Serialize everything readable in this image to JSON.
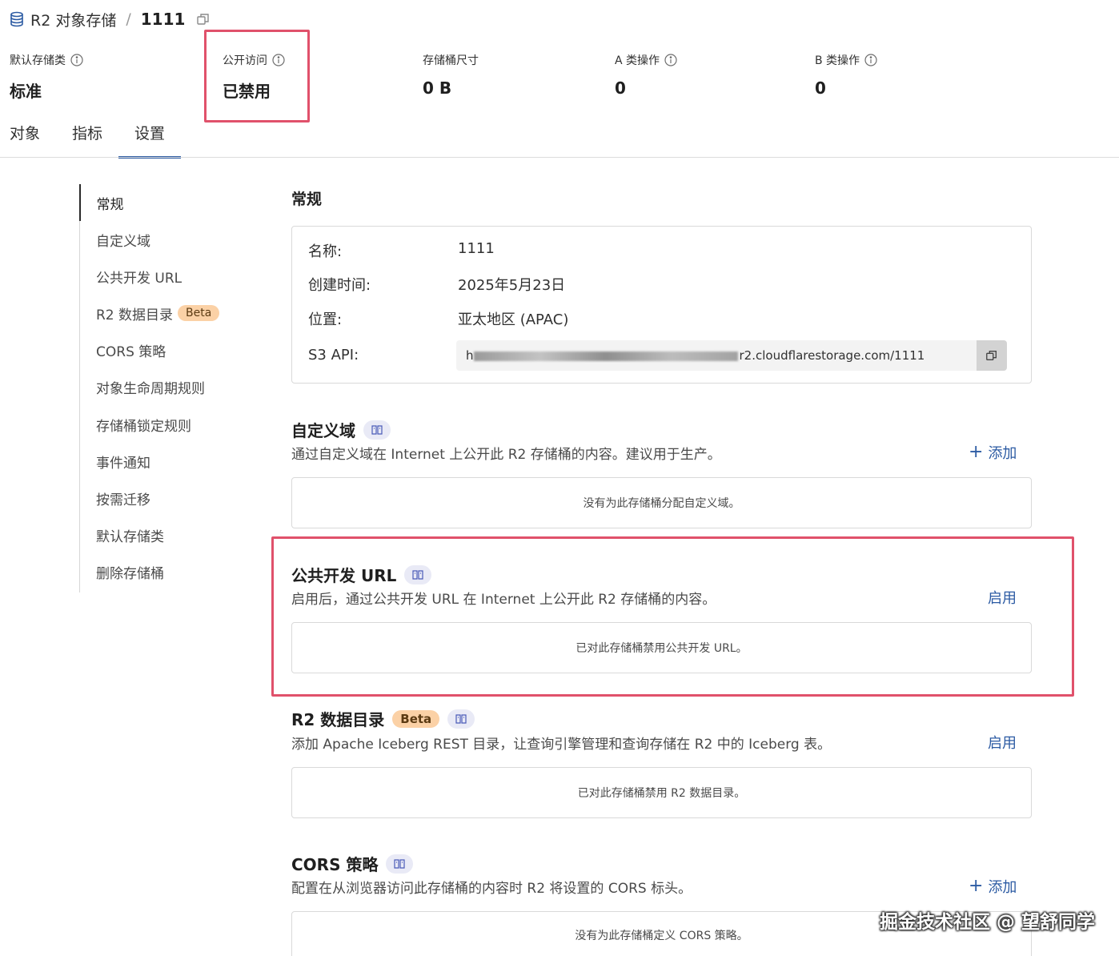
{
  "header": {
    "parent": "R2 对象存储",
    "separator": "/",
    "bucket": "1111"
  },
  "stats": [
    {
      "label": "默认存储类",
      "value": "标准"
    },
    {
      "label": "公开访问",
      "value": "已禁用"
    },
    {
      "label": "存储桶尺寸",
      "value": "0 B"
    },
    {
      "label": "A 类操作",
      "value": "0"
    },
    {
      "label": "B 类操作",
      "value": "0"
    }
  ],
  "tabs": [
    "对象",
    "指标",
    "设置"
  ],
  "sidenav": {
    "items": [
      "常规",
      "自定义域",
      "公共开发 URL",
      "R2 数据目录",
      "CORS 策略",
      "对象生命周期规则",
      "存储桶锁定规则",
      "事件通知",
      "按需迁移",
      "默认存储类",
      "删除存储桶"
    ],
    "beta": "Beta"
  },
  "general": {
    "title": "常规",
    "name_label": "名称:",
    "name_value": "1111",
    "created_label": "创建时间:",
    "created_value": "2025年5月23日",
    "location_label": "位置:",
    "location_value": "亚太地区 (APAC)",
    "s3_label": "S3 API:",
    "s3_prefix": "h",
    "s3_suffix": "r2.cloudflarestorage.com/1111"
  },
  "custom_domain": {
    "title": "自定义域",
    "desc": "通过自定义域在 Internet 上公开此 R2 存储桶的内容。建议用于生产。",
    "action": "添加",
    "empty": "没有为此存储桶分配自定义域。"
  },
  "public_url": {
    "title": "公共开发 URL",
    "desc": "启用后，通过公共开发 URL 在 Internet 上公开此 R2 存储桶的内容。",
    "action": "启用",
    "empty": "已对此存储桶禁用公共开发 URL。"
  },
  "data_catalog": {
    "title": "R2 数据目录",
    "beta": "Beta",
    "desc": "添加 Apache Iceberg REST 目录，让查询引擎管理和查询存储在 R2 中的 Iceberg 表。",
    "action": "启用",
    "empty": "已对此存储桶禁用 R2 数据目录。"
  },
  "cors": {
    "title": "CORS 策略",
    "desc": "配置在从浏览器访问此存储桶的内容时 R2 将设置的 CORS 标头。",
    "action": "添加",
    "empty": "没有为此存储桶定义 CORS 策略。"
  },
  "watermark": "掘金技术社区 @ 望舒同学",
  "colors": {
    "accent": "#2c5ba3",
    "highlight": "#e0516b",
    "beta_bg": "#fbd1a6"
  }
}
